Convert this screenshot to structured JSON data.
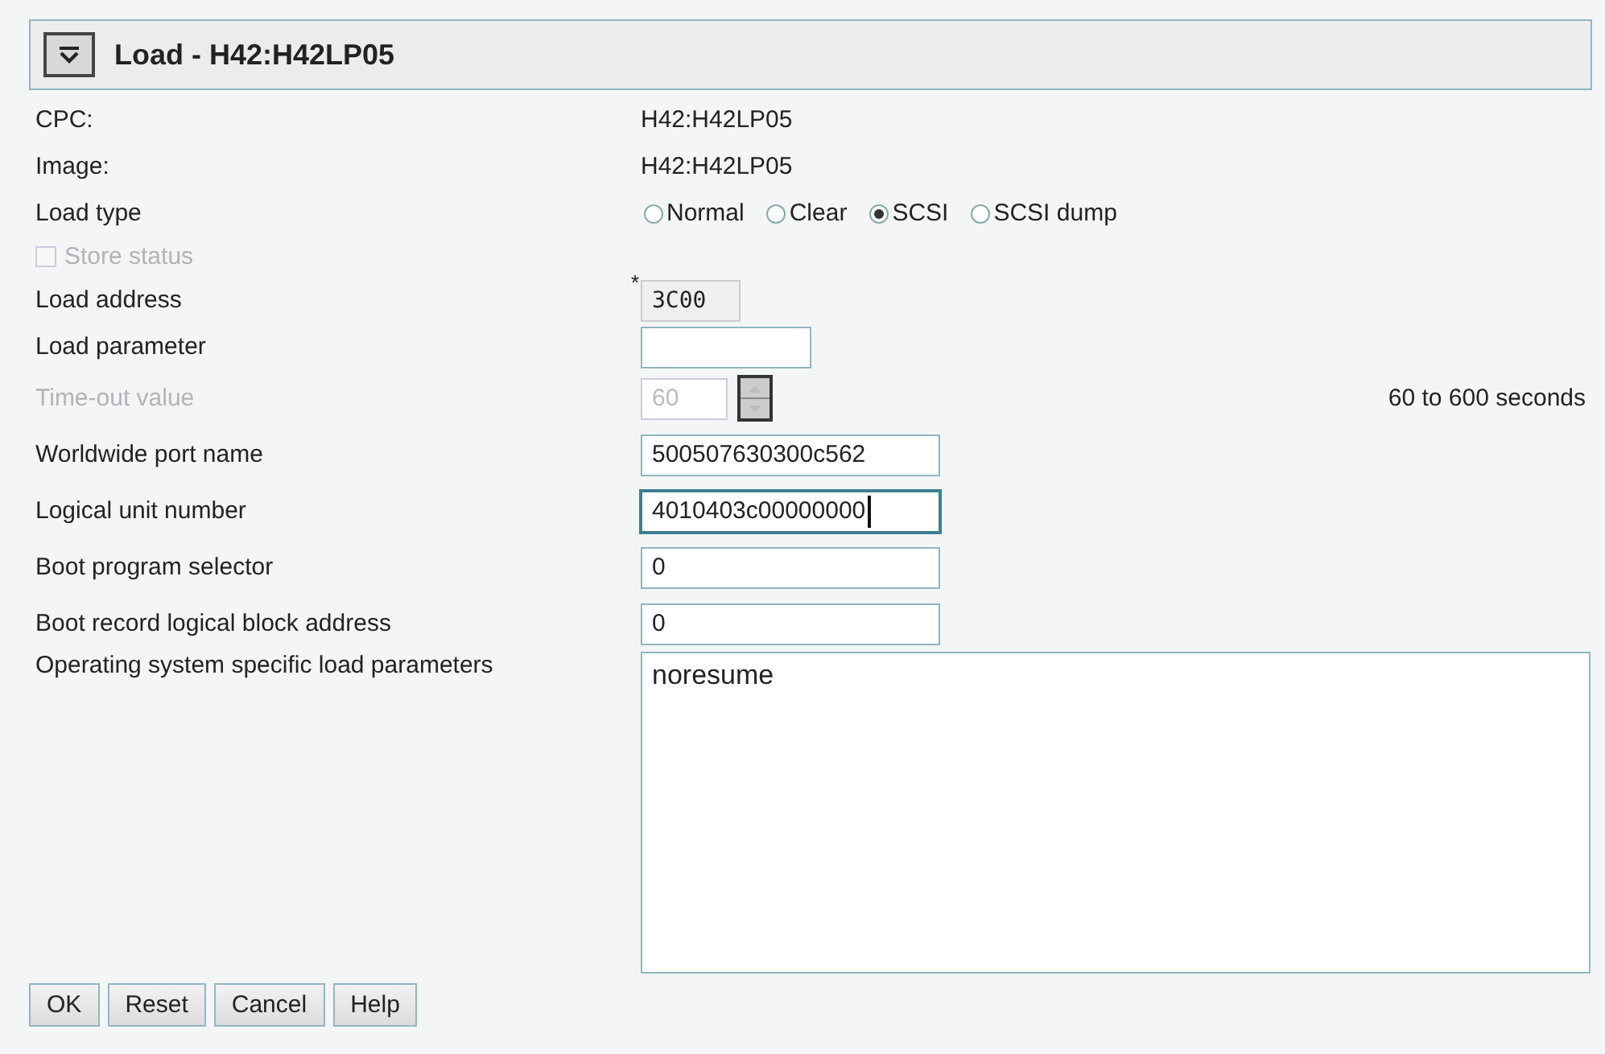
{
  "window": {
    "title": "Load - H42:H42LP05"
  },
  "rows": [
    {
      "kind": "text",
      "label": "CPC:",
      "value": "H42:H42LP05"
    },
    {
      "kind": "text",
      "label": "Image:",
      "value": "H42:H42LP05"
    },
    {
      "kind": "radio",
      "label": "Load type",
      "options": [
        {
          "label": "Normal",
          "selected": false
        },
        {
          "label": "Clear",
          "selected": false
        },
        {
          "label": "SCSI",
          "selected": true
        },
        {
          "label": "SCSI dump",
          "selected": false
        }
      ]
    },
    {
      "kind": "checkbox",
      "label": "Store status",
      "checked": false,
      "disabled": true
    },
    {
      "kind": "code_input",
      "label": "Load address",
      "value": "3C00",
      "required": "*",
      "focused": false
    },
    {
      "kind": "short_input",
      "label": "Load parameter",
      "focused": false
    },
    {
      "kind": "spinner",
      "label": "Time-out value",
      "value": "60",
      "disabled": true,
      "hint": "60 to 600 seconds"
    },
    {
      "kind": "input",
      "label": "Worldwide port name",
      "value": "500507630300c562",
      "focused": false
    },
    {
      "kind": "input",
      "label": "Logical unit number",
      "value": "4010403c00000000",
      "focused": true
    },
    {
      "kind": "input",
      "label": "Boot program selector",
      "value": "0",
      "focused": false
    },
    {
      "kind": "input",
      "label": "Boot record logical block address",
      "value": "0",
      "focused": false
    },
    {
      "kind": "textarea",
      "label": "Operating system specific load parameters",
      "value": "noresume"
    }
  ],
  "buttons": [
    "OK",
    "Reset",
    "Cancel",
    "Help"
  ]
}
